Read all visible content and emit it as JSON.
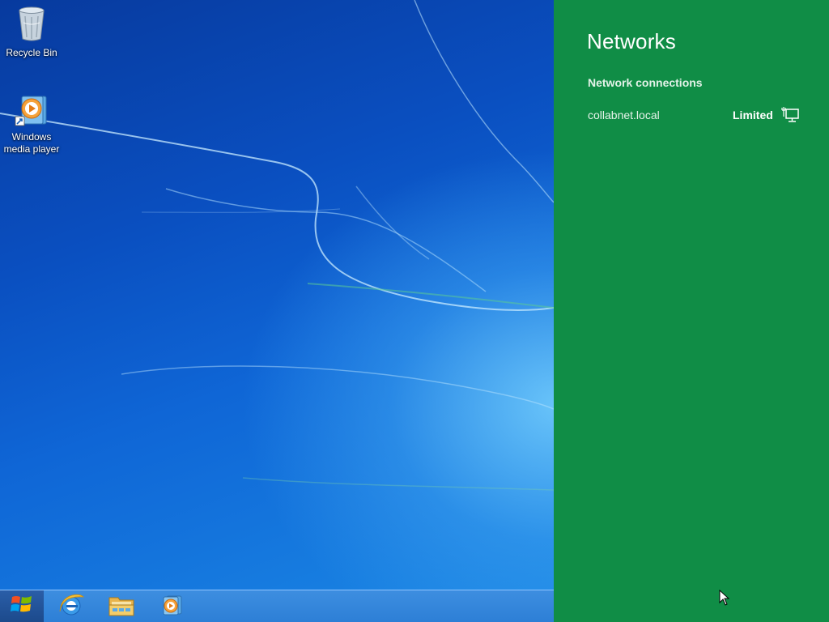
{
  "desktop": {
    "icons": [
      {
        "label": "Recycle Bin",
        "icon": "recycle-bin-icon"
      },
      {
        "label": "Windows media player",
        "icon": "media-player-icon"
      }
    ]
  },
  "taskbar": {
    "start_icon": "windows-logo-icon",
    "pinned": [
      {
        "name": "Internet Explorer",
        "icon": "internet-explorer-icon"
      },
      {
        "name": "File Explorer",
        "icon": "file-explorer-icon"
      },
      {
        "name": "Windows Media Player",
        "icon": "media-player-icon"
      }
    ]
  },
  "networks_panel": {
    "title": "Networks",
    "section_heading": "Network connections",
    "connections": [
      {
        "name": "collabnet.local",
        "status": "Limited",
        "icon": "wired-network-icon"
      }
    ],
    "background_color": "#108d46"
  }
}
